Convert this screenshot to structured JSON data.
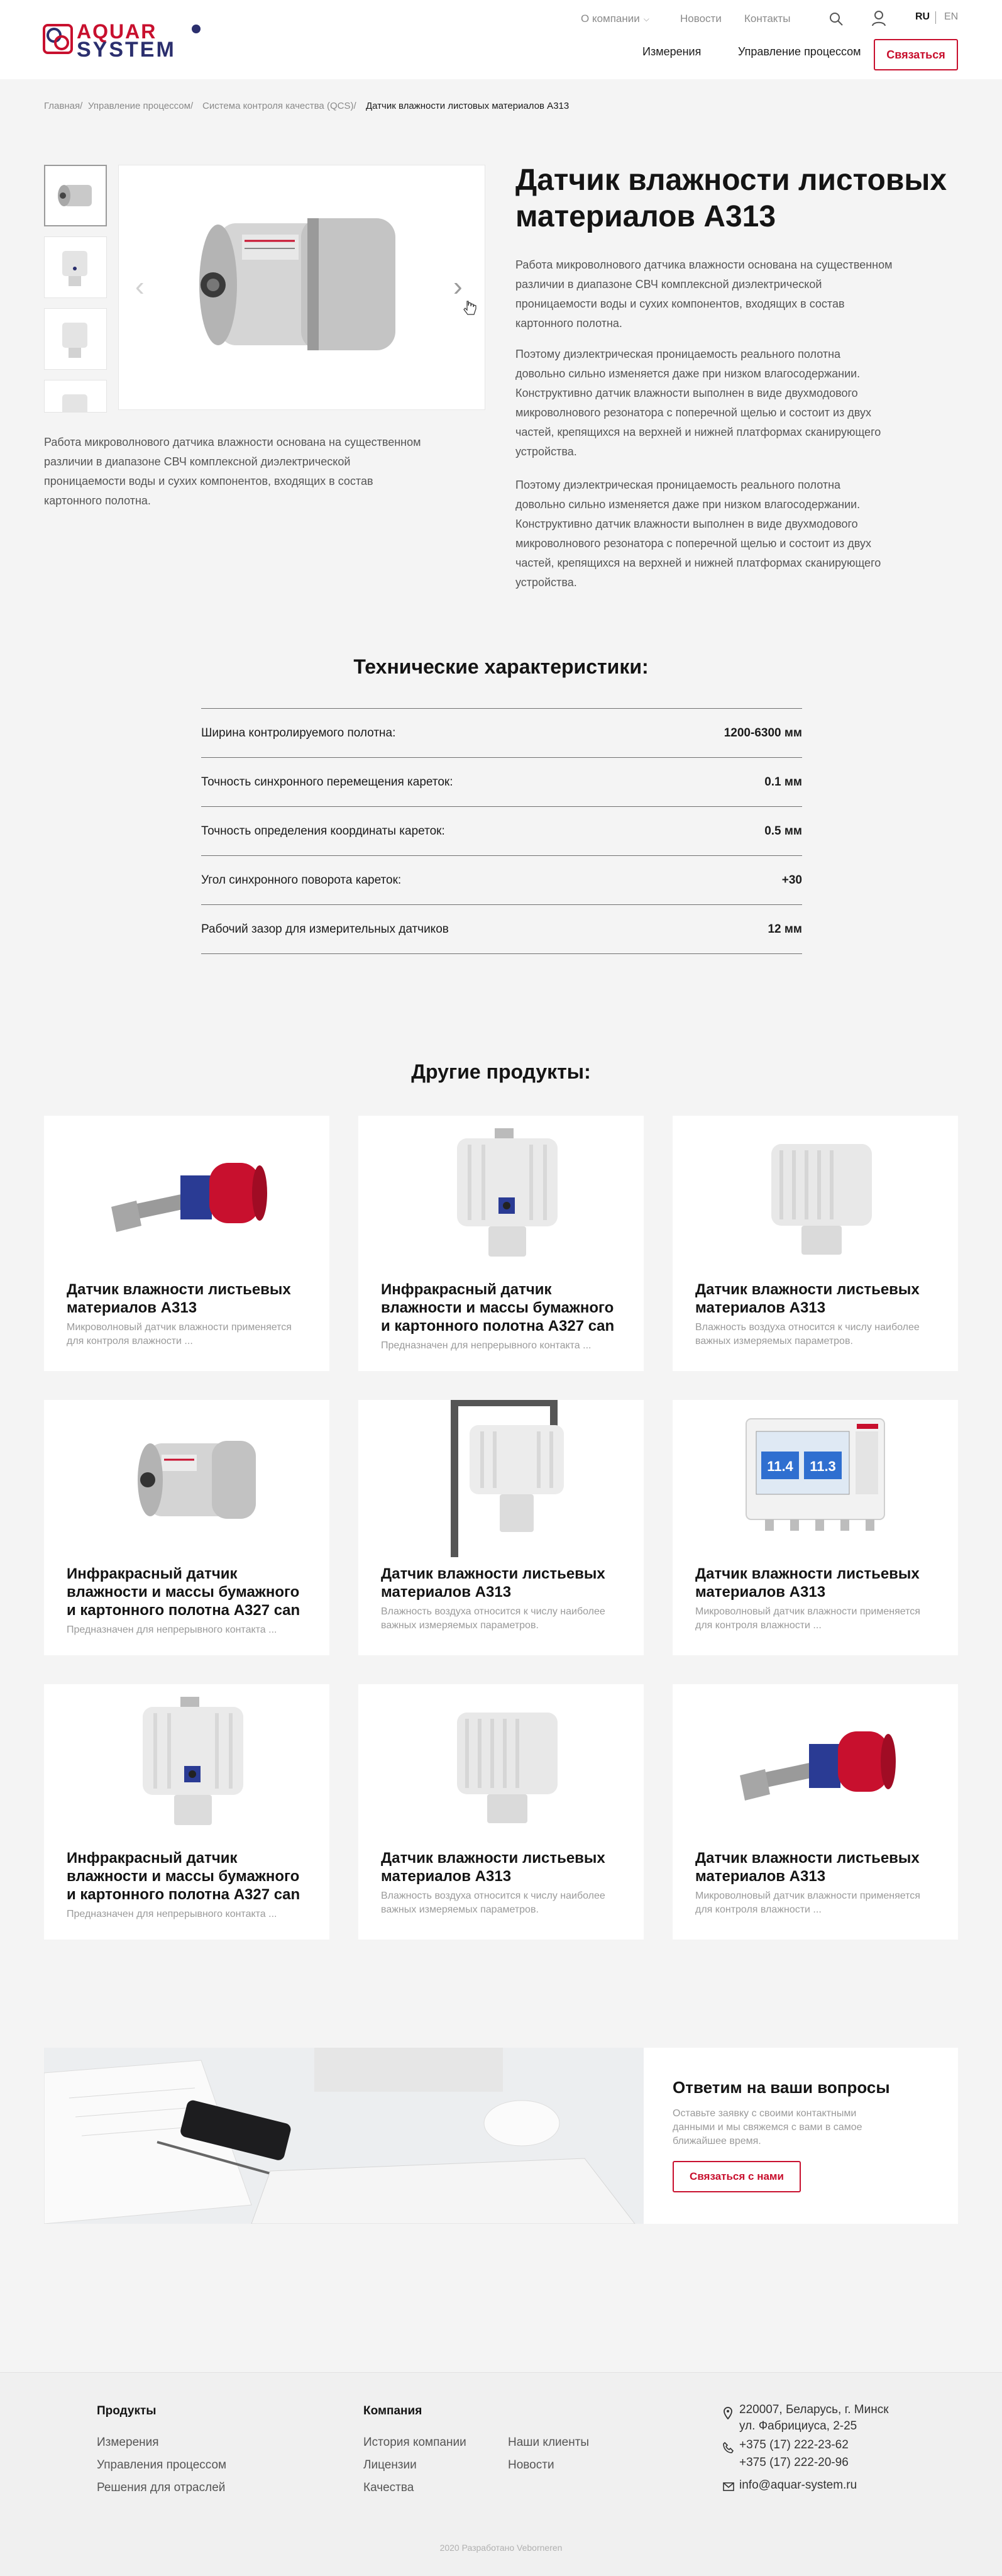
{
  "header": {
    "logo_top": "AQUAR",
    "logo_bottom": "SYSTEM",
    "top_nav": [
      "О компании",
      "Новости",
      "Контакты"
    ],
    "main_nav": [
      "Измерения",
      "Управление процессом"
    ],
    "contact_button": "Связаться",
    "lang_active": "RU",
    "lang_other": "EN"
  },
  "breadcrumb": [
    "Главная/",
    "Управление процессом/",
    "Система контроля качества (QCS)/",
    "Датчик влажности листовых материалов А313"
  ],
  "product": {
    "title": "Датчик влажности листовых материалов А313",
    "paragraphs": [
      "Работа микроволнового датчика влажности основана на существенном различии в диапазоне СВЧ комплексной диэлектрической проницаемости воды и сухих компонентов, входящих в состав картонного полотна.",
      "Поэтому диэлектрическая проницаемость реального полотна довольно сильно изменяется даже при низком влагосодержании. Конструктивно датчик влажности выполнен в виде двухмодового микроволнового резонатора с поперечной щелью и состоит из двух частей, крепящихся на верхней и нижней платформах сканирующего устройства.",
      "Поэтому диэлектрическая проницаемость реального полотна довольно сильно изменяется даже при низком влагосодержании. Конструктивно датчик влажности выполнен в виде двухмодового микроволнового резонатора с поперечной щелью и состоит из двух частей, крепящихся на верхней и нижней платформах сканирующего устройства."
    ],
    "left_caption": "Работа микроволнового датчика влажности основана на существенном различии в диапазоне СВЧ комплексной диэлектрической проницаемости воды и сухих компонентов, входящих в состав картонного полотна."
  },
  "specs": {
    "title": "Технические характеристики:",
    "rows": [
      {
        "label": "Ширина контролируемого полотна:",
        "value": "1200-6300 мм"
      },
      {
        "label": "Точность синхронного перемещения кареток:",
        "value": "0.1 мм"
      },
      {
        "label": "Точность определения координаты кареток:",
        "value": "0.5 мм"
      },
      {
        "label": "Угол синхронного поворота кареток:",
        "value": "+30"
      },
      {
        "label": "Рабочий зазор для измерительных датчиков",
        "value": "12 мм"
      }
    ]
  },
  "other": {
    "title": "Другие продукты:",
    "cards": [
      {
        "name": "Датчик влажности листьевых материалов А313",
        "desc": "Микроволновый датчик влажности применяется для контроля влажности ...",
        "img": "probe"
      },
      {
        "name": "Инфракрасный датчик влажности и массы бумажного и картонного полотна A327 can",
        "desc": "Предназначен для непрерывного контакта ...",
        "img": "box-port"
      },
      {
        "name": "Датчик влажности листьевых материалов А313",
        "desc": "Влажность воздуха относится к числу наиболее важных измеряемых параметров.",
        "img": "box"
      },
      {
        "name": "Инфракрасный датчик влажности и массы бумажного и картонного полотна A327 can",
        "desc": "Предназначен для непрерывного контакта ...",
        "img": "cylinder"
      },
      {
        "name": "Датчик влажности листьевых материалов А313",
        "desc": "Влажность воздуха относится к числу наиболее важных измеряемых параметров.",
        "img": "frame"
      },
      {
        "name": "Датчик влажности листьевых материалов А313",
        "desc": "Микроволновый датчик влажности применяется для контроля влажности ...",
        "img": "panel"
      },
      {
        "name": "Инфракрасный датчик влажности и массы бумажного и картонного полотна A327 can",
        "desc": "Предназначен для непрерывного контакта ...",
        "img": "box-port"
      },
      {
        "name": "Датчик влажности листьевых материалов А313",
        "desc": "Влажность воздуха относится к числу наиболее важных измеряемых параметров.",
        "img": "box"
      },
      {
        "name": "Датчик влажности листьевых материалов А313",
        "desc": "Микроволновый датчик влажности применяется для контроля влажности ...",
        "img": "probe"
      }
    ],
    "panel_readings": [
      "11.4",
      "11.3"
    ]
  },
  "cta": {
    "title": "Ответим на ваши вопросы",
    "text": "Оставьте заявку с своими контактными данными и мы свяжемся с вами в самое ближайшее время.",
    "button": "Связаться с нами"
  },
  "footer": {
    "products_title": "Продукты",
    "products": [
      "Измерения",
      "Управления процессом",
      "Решения для отраслей"
    ],
    "company_title": "Компания",
    "company_col1": [
      "История компании",
      "Лицензии",
      "Качества"
    ],
    "company_col2": [
      "Наши клиенты",
      "Новости"
    ],
    "address_1": "220007, Беларусь, г. Минск",
    "address_2": "ул. Фабрициуса, 2-25",
    "phone_1": "+375 (17) 222-23-62",
    "phone_2": "+375 (17) 222-20-96",
    "email": "info@aquar-system.ru",
    "copyright": "2020 Разработано Veborneren"
  },
  "colors": {
    "accent": "#c8102e",
    "brand_dark": "#2b2f6e"
  }
}
